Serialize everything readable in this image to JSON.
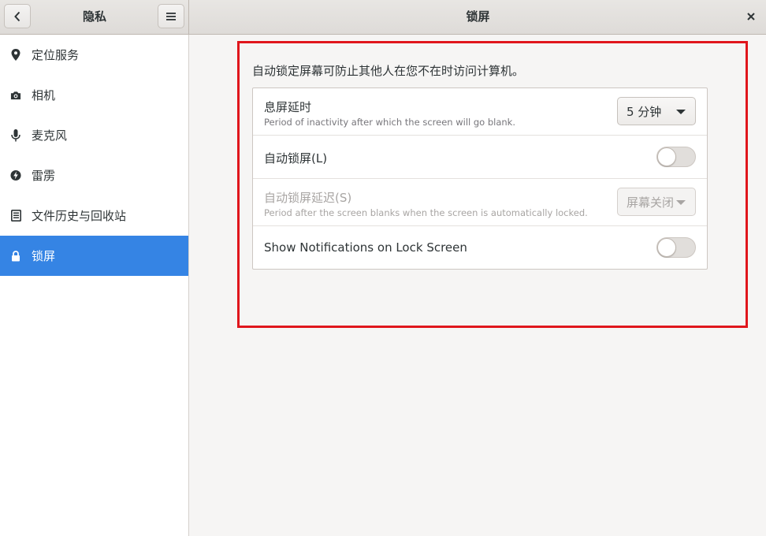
{
  "header": {
    "left_title": "隐私",
    "main_title": "锁屏"
  },
  "sidebar": {
    "items": [
      {
        "label": "定位服务",
        "icon": "location-pin-icon"
      },
      {
        "label": "相机",
        "icon": "camera-icon"
      },
      {
        "label": "麦克风",
        "icon": "microphone-icon"
      },
      {
        "label": "雷雳",
        "icon": "thunderbolt-icon"
      },
      {
        "label": "文件历史与回收站",
        "icon": "document-icon"
      },
      {
        "label": "锁屏",
        "icon": "lock-icon",
        "active": true
      }
    ]
  },
  "main": {
    "description": "自动锁定屏幕可防止其他人在您不在时访问计算机。",
    "rows": {
      "blank_screen": {
        "title": "息屏延时",
        "subtitle": "Period of inactivity after which the screen will go blank.",
        "value": "5 分钟"
      },
      "auto_lock": {
        "title": "自动锁屏(L)",
        "enabled": false
      },
      "lock_delay": {
        "title": "自动锁屏延迟(S)",
        "subtitle": "Period after the screen blanks when the screen is automatically locked.",
        "value": "屏幕关闭",
        "disabled": true
      },
      "notifications": {
        "title": "Show Notifications on Lock Screen",
        "enabled": false
      }
    }
  },
  "colors": {
    "accent": "#3584e4",
    "highlight_border": "#e0161c"
  }
}
